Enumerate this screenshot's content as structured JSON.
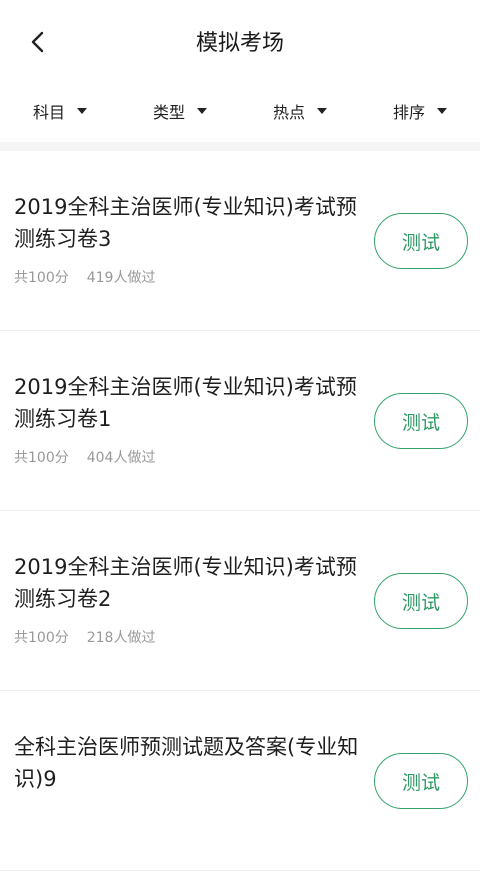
{
  "header": {
    "title": "模拟考场"
  },
  "filters": [
    {
      "label": "科目"
    },
    {
      "label": "类型"
    },
    {
      "label": "热点"
    },
    {
      "label": "排序"
    }
  ],
  "items": [
    {
      "title": "2019全科主治医师(专业知识)考试预测练习卷3",
      "score": "共100分",
      "count": "419人做过",
      "button": "测试"
    },
    {
      "title": "2019全科主治医师(专业知识)考试预测练习卷1",
      "score": "共100分",
      "count": "404人做过",
      "button": "测试"
    },
    {
      "title": "2019全科主治医师(专业知识)考试预测练习卷2",
      "score": "共100分",
      "count": "218人做过",
      "button": "测试"
    },
    {
      "title": "全科主治医师预测试题及答案(专业知识)9",
      "score": "",
      "count": "",
      "button": "测试"
    }
  ],
  "colors": {
    "accent": "#2e9a63",
    "meta": "#999999",
    "band": "#f5f5f5"
  }
}
